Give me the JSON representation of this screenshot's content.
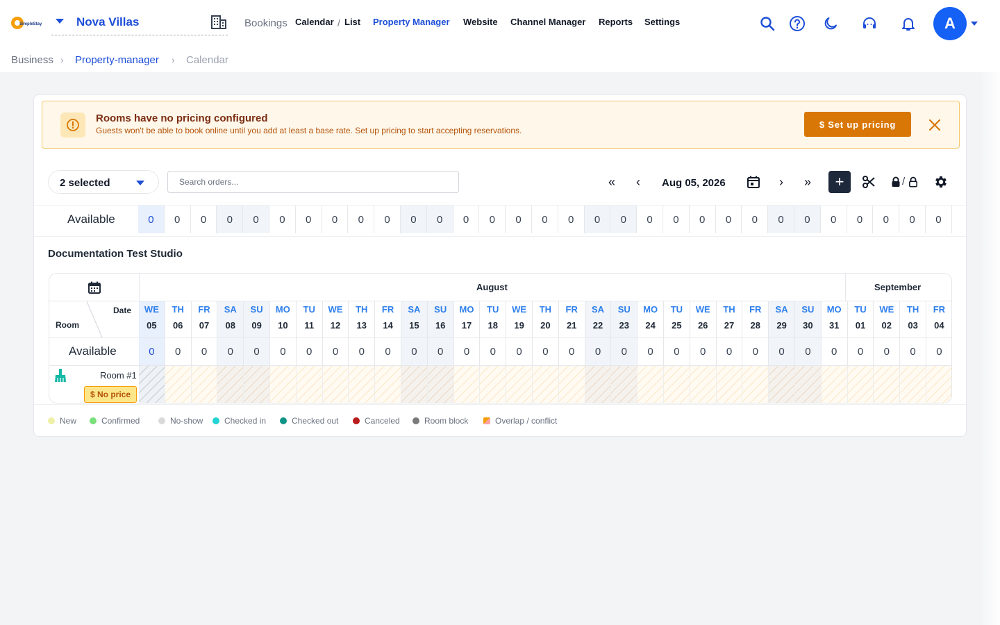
{
  "header": {
    "logo_text": "SimpleStay",
    "property_name": "Nova Villas",
    "nav": {
      "bookings": "Bookings",
      "calendar": "Calendar",
      "slash": "/",
      "list": "List",
      "property_manager": "Property Manager",
      "website": "Website",
      "channel_manager": "Channel Manager",
      "reports": "Reports",
      "settings": "Settings"
    },
    "avatar_letter": "A",
    "accent": "#1560f5"
  },
  "breadcrumb": [
    "Business",
    "Property-manager",
    "Calendar"
  ],
  "alert": {
    "title": "Rooms have no pricing configured",
    "text": "Guests won't be able to book online until you add at least a base rate. Set up pricing to start accepting reservations.",
    "button": "$ Set up pricing",
    "color": "#d97706"
  },
  "toolbar": {
    "selected": "2 selected",
    "search_placeholder": "Search orders...",
    "first": "«",
    "prev": "‹",
    "date": "Aug 05, 2026",
    "next": "›",
    "last": "»",
    "add": "+",
    "lock_sep": "/"
  },
  "calendar": {
    "available_label": "Available",
    "section_title": "Documentation Test Studio",
    "date_header": "Date",
    "room_header": "Room",
    "months": [
      "August",
      "September"
    ],
    "days": [
      {
        "dn": "WE",
        "dd": "05",
        "type": "today"
      },
      {
        "dn": "TH",
        "dd": "06",
        "type": ""
      },
      {
        "dn": "FR",
        "dd": "07",
        "type": ""
      },
      {
        "dn": "SA",
        "dd": "08",
        "type": "we"
      },
      {
        "dn": "SU",
        "dd": "09",
        "type": "we"
      },
      {
        "dn": "MO",
        "dd": "10",
        "type": ""
      },
      {
        "dn": "TU",
        "dd": "11",
        "type": ""
      },
      {
        "dn": "WE",
        "dd": "12",
        "type": ""
      },
      {
        "dn": "TH",
        "dd": "13",
        "type": ""
      },
      {
        "dn": "FR",
        "dd": "14",
        "type": ""
      },
      {
        "dn": "SA",
        "dd": "15",
        "type": "we"
      },
      {
        "dn": "SU",
        "dd": "16",
        "type": "we"
      },
      {
        "dn": "MO",
        "dd": "17",
        "type": ""
      },
      {
        "dn": "TU",
        "dd": "18",
        "type": ""
      },
      {
        "dn": "WE",
        "dd": "19",
        "type": ""
      },
      {
        "dn": "TH",
        "dd": "20",
        "type": ""
      },
      {
        "dn": "FR",
        "dd": "21",
        "type": ""
      },
      {
        "dn": "SA",
        "dd": "22",
        "type": "we"
      },
      {
        "dn": "SU",
        "dd": "23",
        "type": "we"
      },
      {
        "dn": "MO",
        "dd": "24",
        "type": ""
      },
      {
        "dn": "TU",
        "dd": "25",
        "type": ""
      },
      {
        "dn": "WE",
        "dd": "26",
        "type": ""
      },
      {
        "dn": "TH",
        "dd": "27",
        "type": ""
      },
      {
        "dn": "FR",
        "dd": "28",
        "type": ""
      },
      {
        "dn": "SA",
        "dd": "29",
        "type": "we"
      },
      {
        "dn": "SU",
        "dd": "30",
        "type": "we"
      },
      {
        "dn": "MO",
        "dd": "31",
        "type": ""
      },
      {
        "dn": "TU",
        "dd": "01",
        "type": ""
      },
      {
        "dn": "WE",
        "dd": "02",
        "type": ""
      },
      {
        "dn": "TH",
        "dd": "03",
        "type": ""
      },
      {
        "dn": "FR",
        "dd": "04",
        "type": ""
      }
    ],
    "available_values": [
      "0",
      "0",
      "0",
      "0",
      "0",
      "0",
      "0",
      "0",
      "0",
      "0",
      "0",
      "0",
      "0",
      "0",
      "0",
      "0",
      "0",
      "0",
      "0",
      "0",
      "0",
      "0",
      "0",
      "0",
      "0",
      "0",
      "0",
      "0",
      "0",
      "0",
      "0"
    ],
    "room_name": "Room #1",
    "no_price_badge": "$ No price"
  },
  "legend": [
    {
      "label": "New",
      "color": "#eef0a5"
    },
    {
      "label": "Confirmed",
      "color": "#7ae07a"
    },
    {
      "label": "No-show",
      "color": "#d9d9d9"
    },
    {
      "label": "Checked in",
      "color": "#22d3d3"
    },
    {
      "label": "Checked out",
      "color": "#0f9488"
    },
    {
      "label": "Canceled",
      "color": "#b91c1c"
    },
    {
      "label": "Room block",
      "color": "#7a7a7a"
    },
    {
      "label": "Overlap / conflict",
      "color": "#f59e0b"
    }
  ]
}
